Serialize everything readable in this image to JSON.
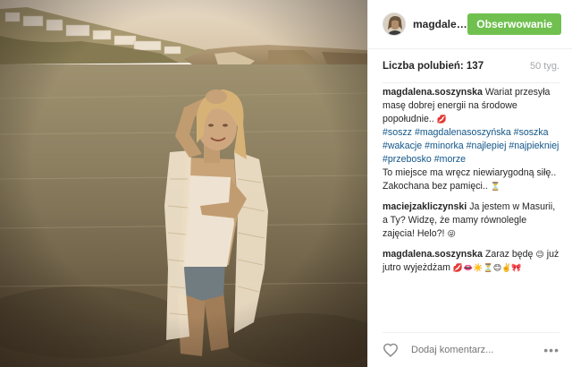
{
  "header": {
    "username": "magdalena.soszynska",
    "follow_label": "Obserwowanie"
  },
  "stats": {
    "likes_text": "Liczba polubień: 137",
    "age_text": "50 tyg."
  },
  "caption": {
    "user": "magdalena.soszynska",
    "text_1": "Wariat przesyła masę dobrej energii na środowe popołudnie..",
    "emoji_1": "💋",
    "hashtags": [
      "#soszz",
      "#magdalenasoszyńska",
      "#soszka",
      "#wakacje",
      "#minorka",
      "#najlepiej",
      "#najpiekniej",
      "#przebosko",
      "#morze"
    ],
    "text_2": "To miejsce ma wręcz niewiarygodną siłę.. Zakochana bez pamięci..",
    "emoji_2": "⏳"
  },
  "comments": [
    {
      "user": "maciejzakliczynski",
      "text": "Ja jestem w Masurii, a Ty? Widzę, że mamy równolegle zajęcia! Helo?!",
      "emoji": "😜"
    },
    {
      "user": "magdalena.soszynska",
      "text": "Zaraz będę",
      "emoji": "😉",
      "text_after": "już jutro wyjeżdżam",
      "emoji_after": "💋👄☀️⏳😊✌️🎀"
    }
  ],
  "footer": {
    "comment_placeholder": "Dodaj komentarz...",
    "more_label": "•••"
  },
  "icons": {
    "like": "heart-icon",
    "more": "more-options-icon"
  }
}
